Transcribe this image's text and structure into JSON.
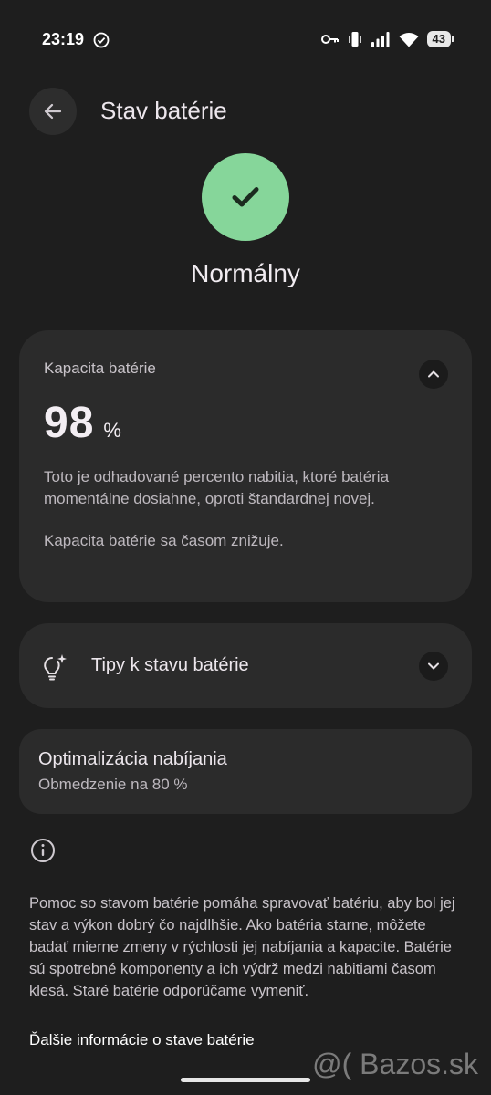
{
  "status_bar": {
    "time": "23:19",
    "battery_level": "43",
    "icons": [
      "check-circle-icon",
      "key-icon",
      "vibrate-icon",
      "signal-icon",
      "wifi-icon",
      "battery-icon"
    ]
  },
  "header": {
    "title": "Stav batérie",
    "back_icon": "arrow-left-icon"
  },
  "health": {
    "status": "Normálny",
    "icon": "check-icon",
    "color": "#86d69a"
  },
  "capacity_card": {
    "label": "Kapacita batérie",
    "value": "98",
    "unit": "%",
    "description": "Toto je odhadované percento nabitia, ktoré batéria momentálne dosiahne, oproti štandardnej novej.",
    "note": "Kapacita batérie sa časom znižuje.",
    "toggle_icon": "chevron-up-icon"
  },
  "tips_card": {
    "label": "Tipy k stavu batérie",
    "icon": "lightbulb-sparkle-icon",
    "toggle_icon": "chevron-down-icon"
  },
  "optimization_card": {
    "title": "Optimalizácia nabíjania",
    "subtitle": "Obmedzenie na 80 %"
  },
  "info": {
    "icon": "info-icon",
    "text": "Pomoc so stavom batérie pomáha spravovať batériu, aby bol jej stav a výkon dobrý čo najdlhšie. Ako batéria starne, môžete badať mierne zmeny v rýchlosti jej nabíjania a kapacite. Batérie sú spotrebné komponenty a ich výdrž medzi nabitiami časom klesá. Staré batérie odporúčame vymeniť.",
    "link": "Ďalšie informácie o stave batérie"
  },
  "watermark": "@( Bazos.sk"
}
